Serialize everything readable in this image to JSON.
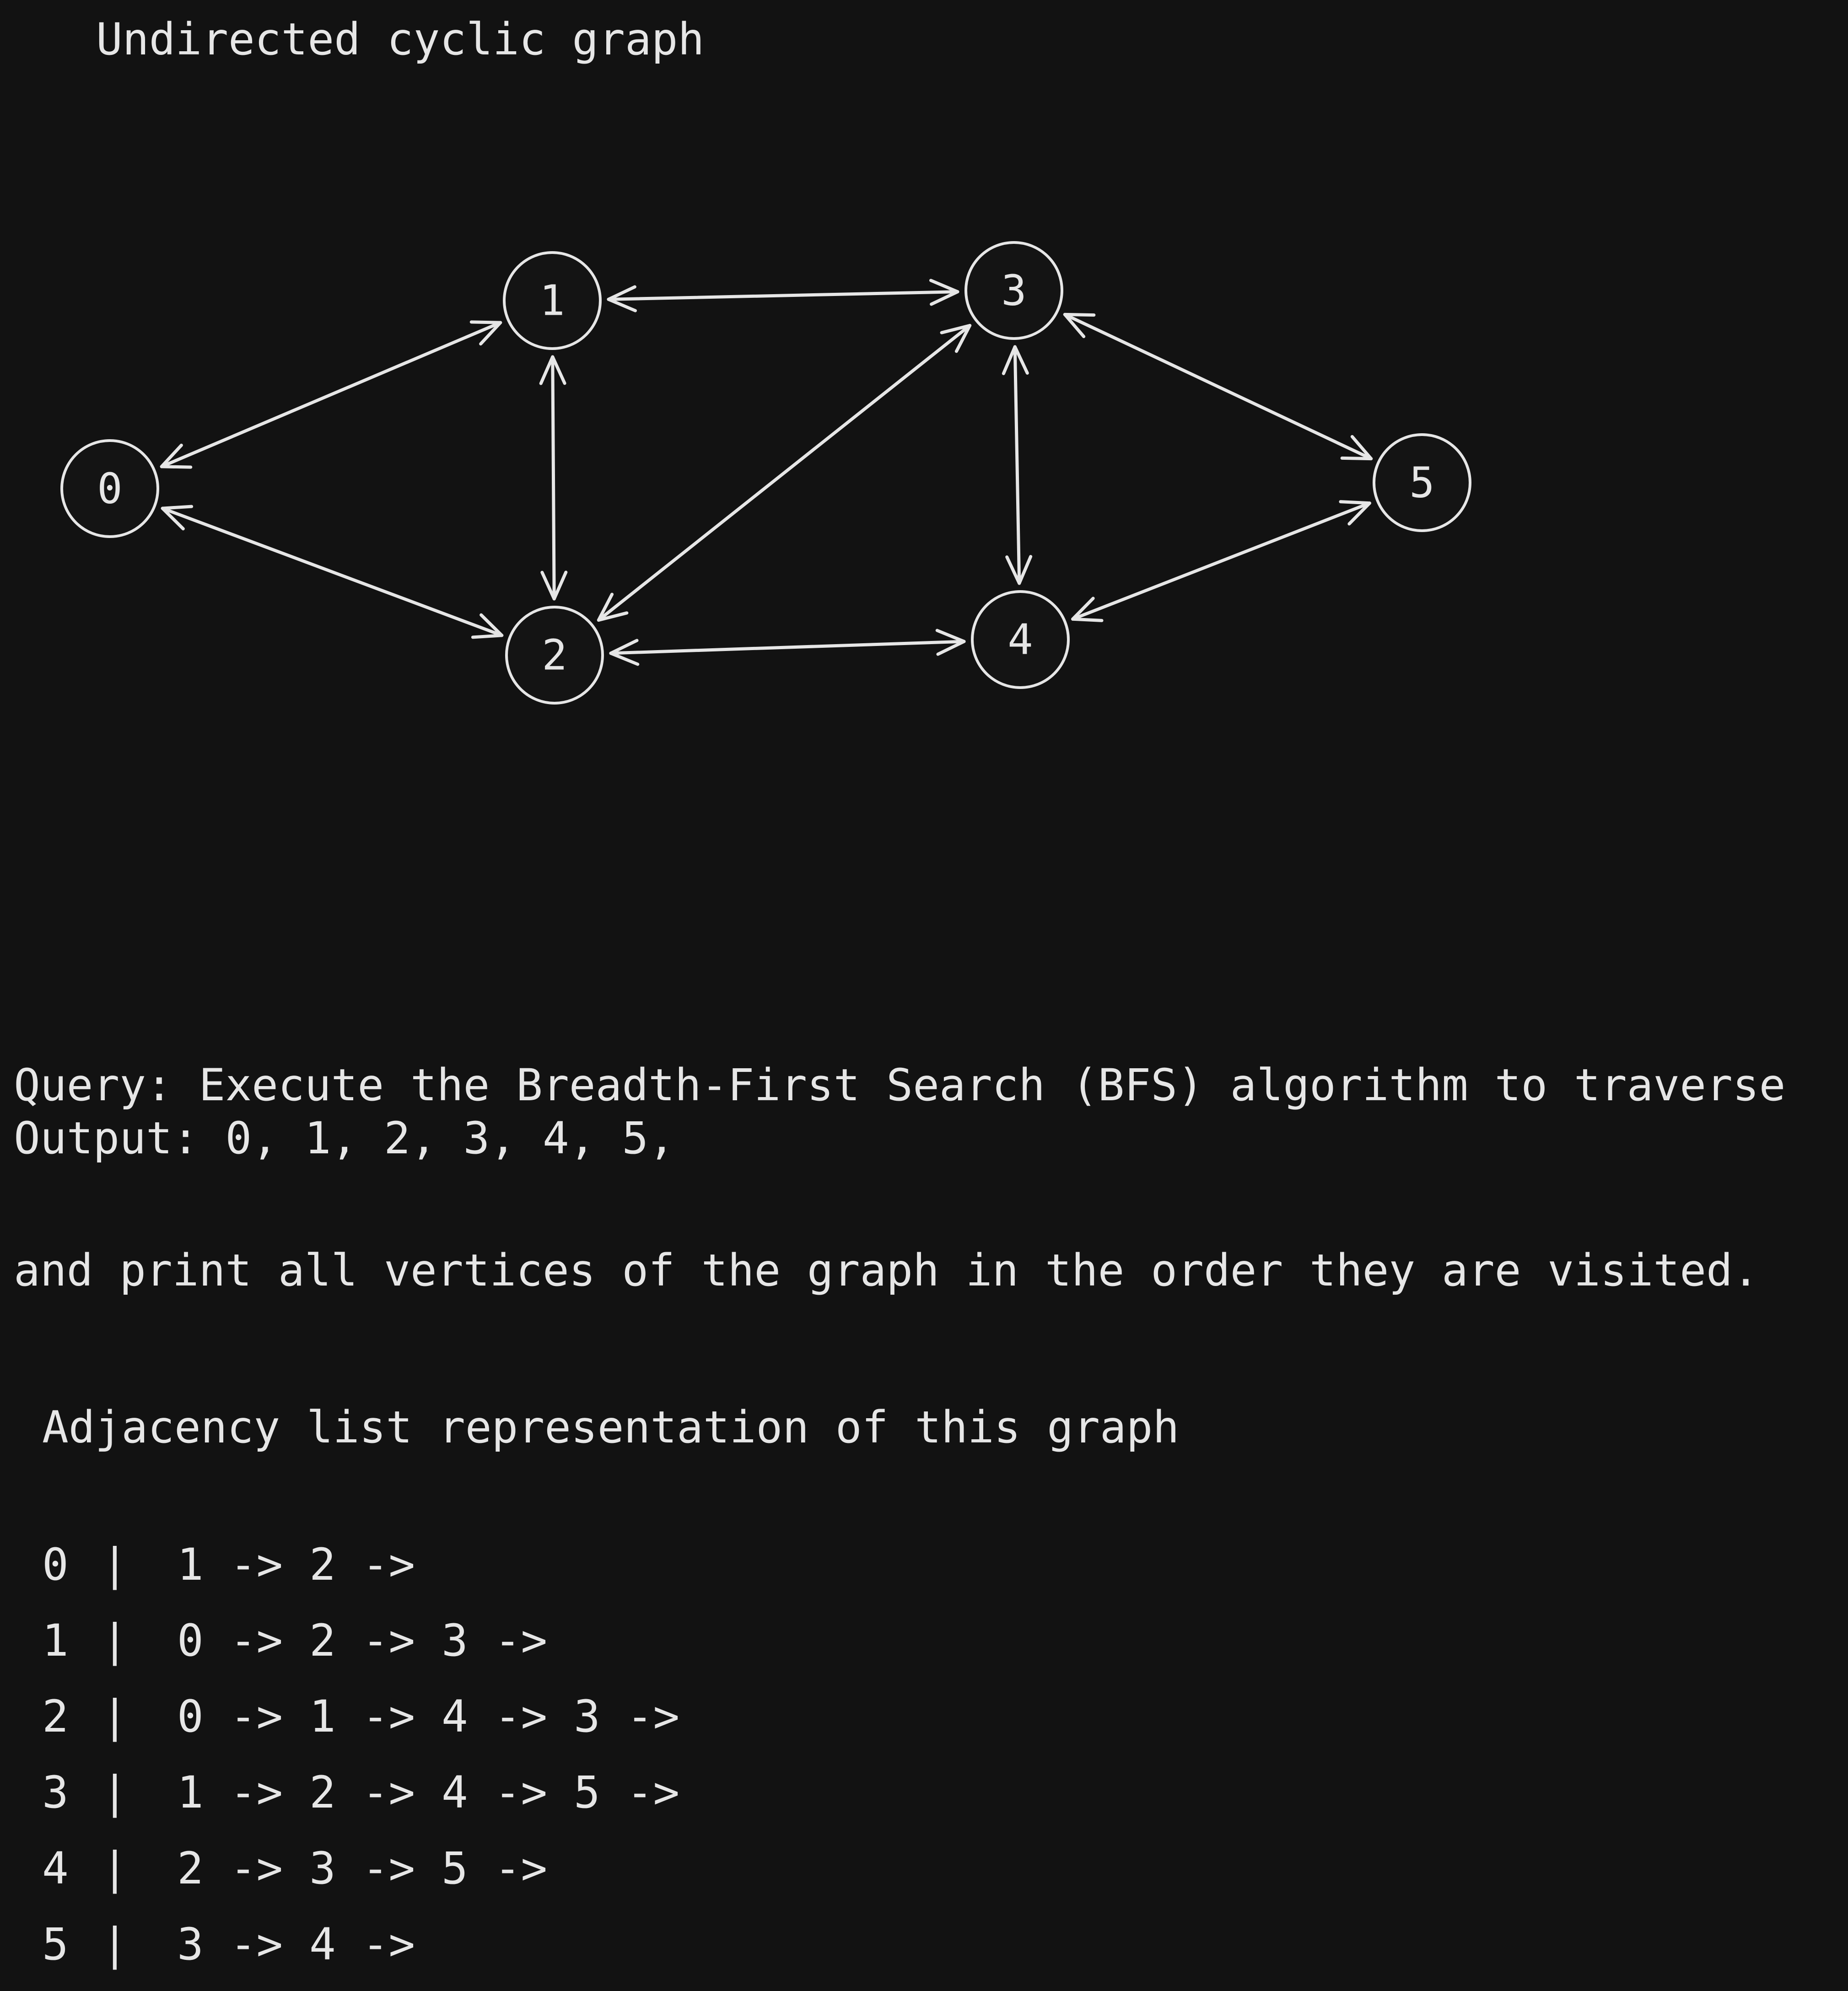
{
  "graph": {
    "title": "Undirected cyclic graph",
    "nodes": [
      {
        "id": "0",
        "label": "0"
      },
      {
        "id": "1",
        "label": "1"
      },
      {
        "id": "2",
        "label": "2"
      },
      {
        "id": "3",
        "label": "3"
      },
      {
        "id": "4",
        "label": "4"
      },
      {
        "id": "5",
        "label": "5"
      }
    ],
    "edges": [
      {
        "from": "0",
        "to": "1",
        "arrows": "both"
      },
      {
        "from": "0",
        "to": "2",
        "arrows": "both"
      },
      {
        "from": "1",
        "to": "3",
        "arrows": "both"
      },
      {
        "from": "1",
        "to": "2",
        "arrows": "both"
      },
      {
        "from": "3",
        "to": "2",
        "arrows": "both"
      },
      {
        "from": "3",
        "to": "4",
        "arrows": "both"
      },
      {
        "from": "3",
        "to": "5",
        "arrows": "both"
      },
      {
        "from": "2",
        "to": "4",
        "arrows": "both"
      },
      {
        "from": "4",
        "to": "5",
        "arrows": "both"
      }
    ]
  },
  "query": {
    "line1": "Query: Execute the Breadth-First Search (BFS) algorithm to traverse",
    "line2": "and print all vertices of the graph in the order they are visited."
  },
  "output": {
    "text": "Output: 0, 1, 2, 3, 4, 5,"
  },
  "adjacency": {
    "title": "Adjacency list representation of this graph",
    "separator": "|",
    "rows": [
      {
        "vertex": "0",
        "list": "1 -> 2 ->"
      },
      {
        "vertex": "1",
        "list": "0 -> 2 -> 3 ->"
      },
      {
        "vertex": "2",
        "list": "0 -> 1 -> 4 -> 3 ->"
      },
      {
        "vertex": "3",
        "list": "1 -> 2 -> 4 -> 5 ->"
      },
      {
        "vertex": "4",
        "list": "2 -> 3 -> 5 ->"
      },
      {
        "vertex": "5",
        "list": "3 -> 4 ->"
      }
    ]
  }
}
